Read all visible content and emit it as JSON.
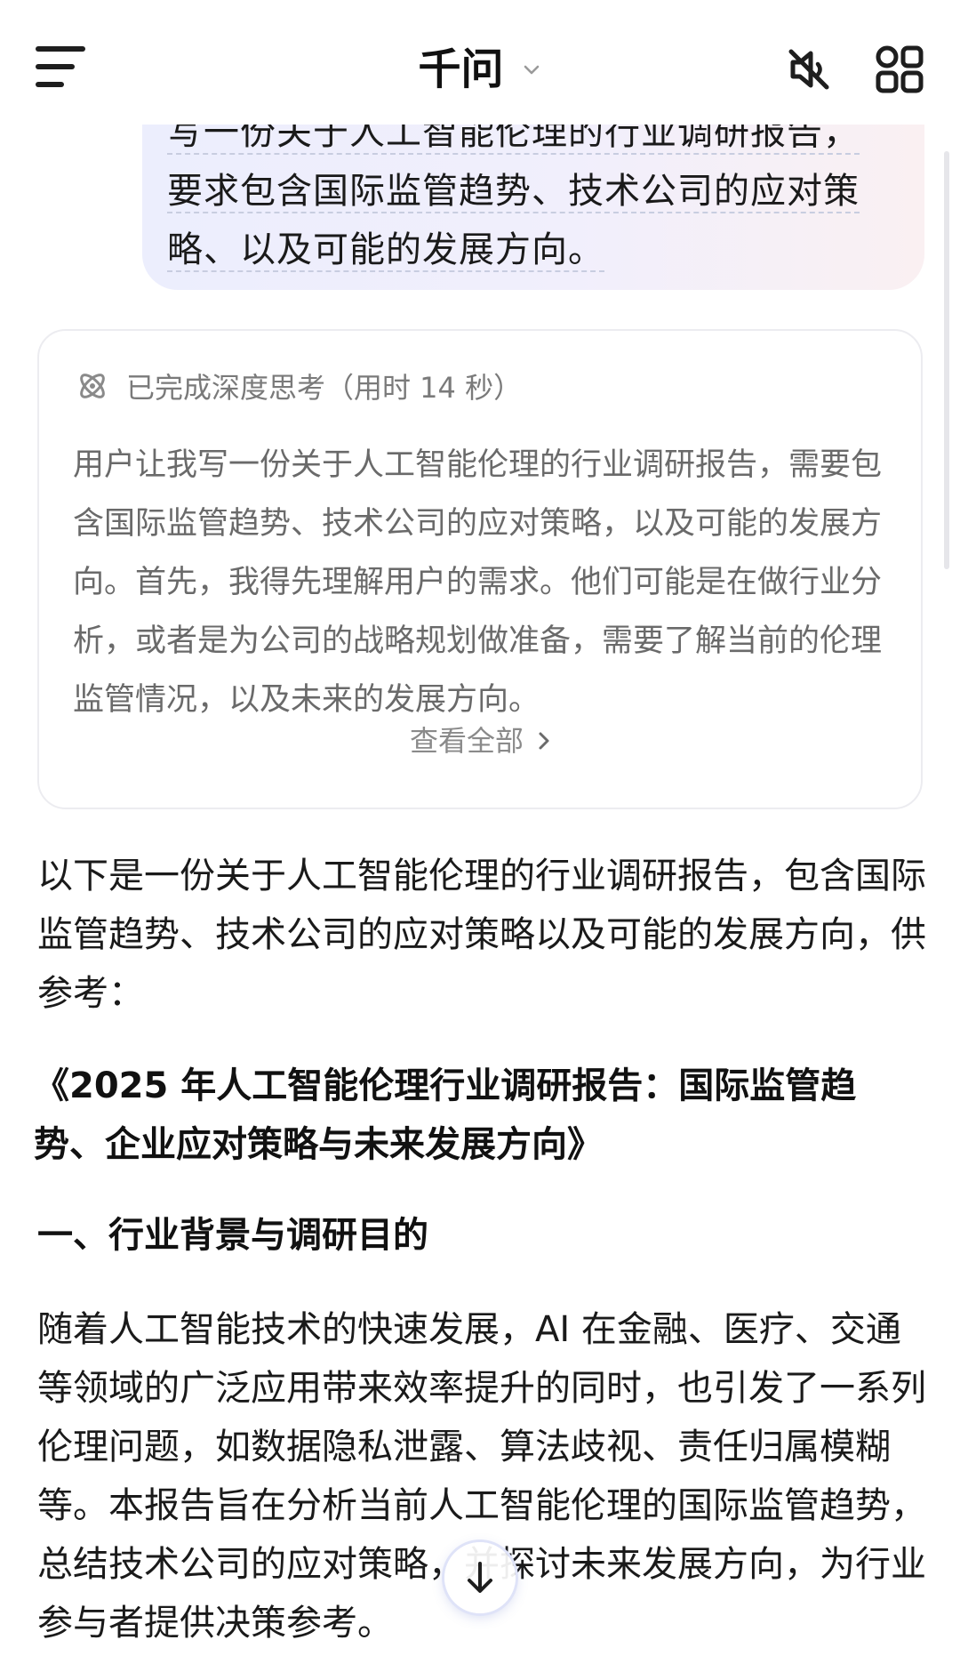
{
  "header": {
    "title": "千问",
    "icons": [
      "menu-icon",
      "chevron-down-icon",
      "mute-icon",
      "grid-icon"
    ]
  },
  "user_message": {
    "lines": [
      "写一份关于人工智能伦理的行业调研报告，",
      "要求包含国际监管趋势、技术公司的应对策",
      "略、以及可能的发展方向。"
    ]
  },
  "thinking": {
    "status": "已完成深度思考（用时 14 秒）",
    "content": "用户让我写一份关于人工智能伦理的行业调研报告，需要包含国际监管趋势、技术公司的应对策略，以及可能的发展方向。首先，我得先理解用户的需求。他们可能是在做行业分析，或者是为公司的战略规划做准备，需要了解当前的伦理监管情况，以及未来的发展方向。",
    "view_all": "查看全部"
  },
  "answer": {
    "intro": "以下是一份关于人工智能伦理的行业调研报告，包含国际监管趋势、技术公司的应对策略以及可能的发展方向，供参考：",
    "report_title": "《2025 年人工智能伦理行业调研报告：国际监管趋势、企业应对策略与未来发展方向》",
    "section_heading": "一、行业背景与调研目的",
    "section_body": "随着人工智能技术的快速发展，AI 在金融、医疗、交通等领域的广泛应用带来效率提升的同时，也引发了一系列伦理问题，如数据隐私泄露、算法歧视、责任归属模糊等。本报告旨在分析当前人工智能伦理的国际监管趋势，总结技术公司的应对策略，并探讨未来发展方向，为行业参与者提供决策参考。"
  },
  "colors": {
    "bubble_start": "#eceefd",
    "bubble_end": "#faf0f2",
    "muted_text": "#6a6a6a",
    "primary_text": "#1a1a1a",
    "scroll_button_accent": "#5a6ec8"
  }
}
